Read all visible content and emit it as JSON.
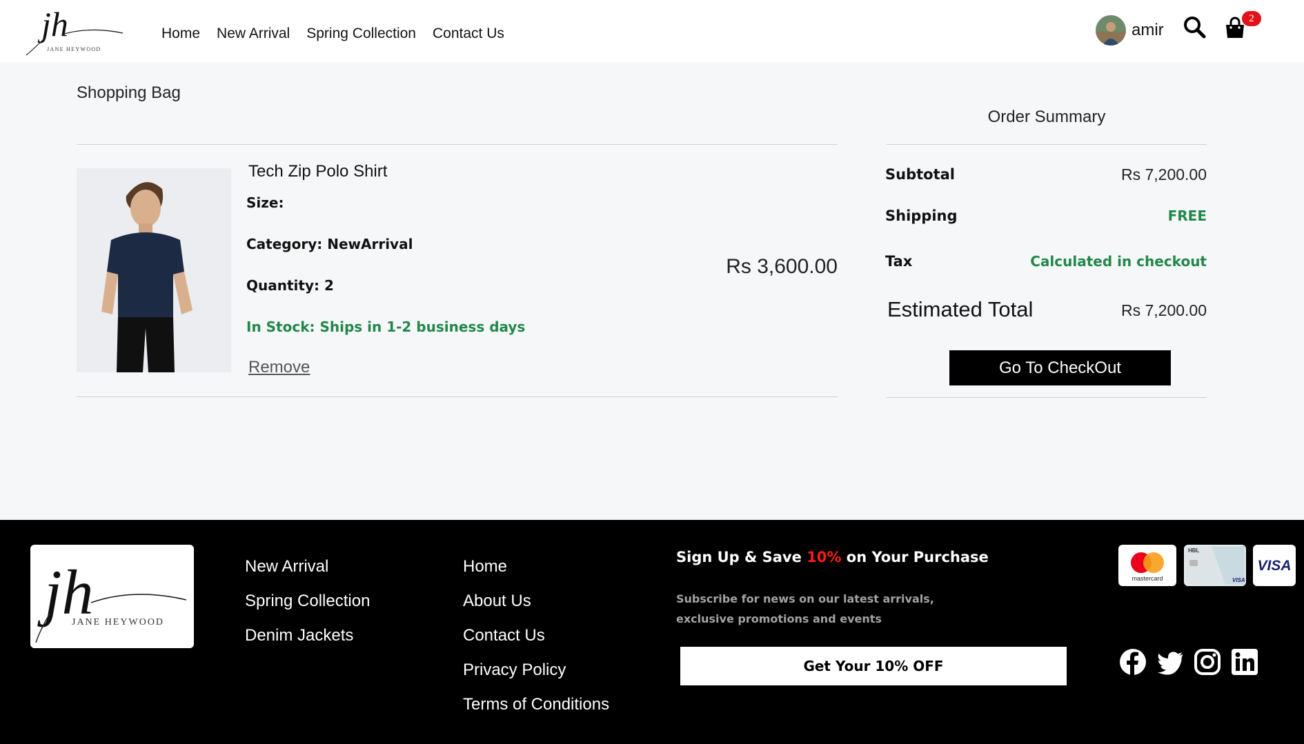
{
  "header": {
    "logo_initials": "jh",
    "logo_brand": "JANE HEYWOOD",
    "nav": [
      "Home",
      "New Arrival",
      "Spring Collection",
      "Contact Us"
    ],
    "user_name": "amir",
    "cart_count": "2"
  },
  "bag": {
    "title": "Shopping Bag",
    "item": {
      "name": "Tech Zip Polo Shirt",
      "size": "Size:",
      "category": "Category: NewArrival",
      "quantity": "Quantity: 2",
      "stock": "In Stock: Ships in 1-2 business days",
      "remove": "Remove",
      "price": "Rs 3,600.00"
    }
  },
  "summary": {
    "title": "Order Summary",
    "subtotal_label": "Subtotal",
    "subtotal_value": "Rs 7,200.00",
    "shipping_label": "Shipping",
    "shipping_value": "FREE",
    "tax_label": "Tax",
    "tax_value": "Calculated in checkout",
    "total_label": "Estimated Total",
    "total_value": "Rs 7,200.00",
    "checkout_button": "Go To CheckOut"
  },
  "footer": {
    "logo_initials": "jh",
    "logo_brand": "JANE HEYWOOD",
    "col1": [
      "New Arrival",
      "Spring Collection",
      "Denim Jackets"
    ],
    "col2": [
      "Home",
      "About Us",
      "Contact Us",
      "Privacy Policy",
      "Terms of Conditions"
    ],
    "signup_pre": "Sign Up & Save ",
    "signup_highlight": "10%",
    "signup_post": " on Your Purchase",
    "signup_sub": "Subscribe for news on our latest arrivals, exclusive promotions and events",
    "offer_button": "Get Your 10% OFF",
    "cards": [
      "mastercard",
      "HBL",
      "VISA"
    ],
    "social_icons": [
      "facebook-icon",
      "twitter-icon",
      "instagram-icon",
      "linkedin-icon"
    ]
  },
  "colors": {
    "green": "#22874a",
    "badge_red": "#e0131a",
    "highlight_red": "#ff1a1a"
  }
}
